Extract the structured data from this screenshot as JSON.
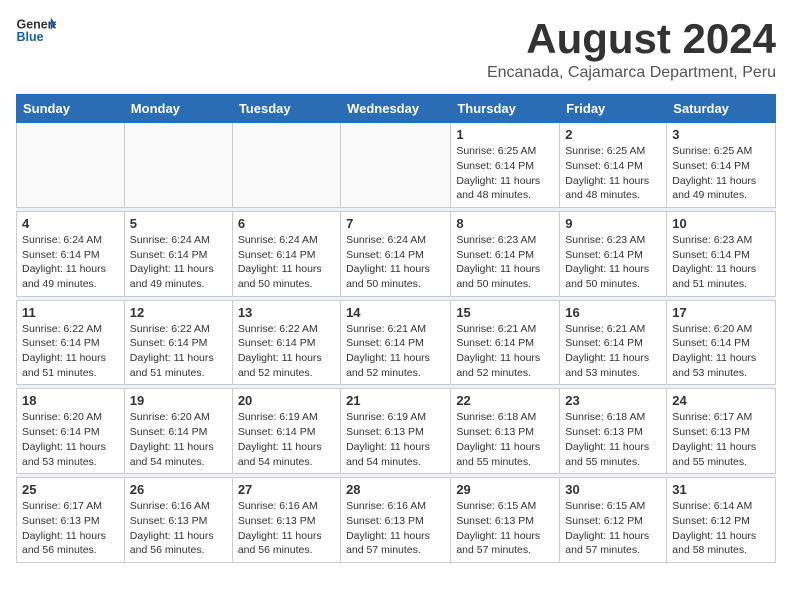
{
  "logo": {
    "general": "General",
    "blue": "Blue"
  },
  "title": {
    "month_year": "August 2024",
    "location": "Encanada, Cajamarca Department, Peru"
  },
  "weekdays": [
    "Sunday",
    "Monday",
    "Tuesday",
    "Wednesday",
    "Thursday",
    "Friday",
    "Saturday"
  ],
  "weeks": [
    [
      {
        "day": "",
        "info": ""
      },
      {
        "day": "",
        "info": ""
      },
      {
        "day": "",
        "info": ""
      },
      {
        "day": "",
        "info": ""
      },
      {
        "day": "1",
        "info": "Sunrise: 6:25 AM\nSunset: 6:14 PM\nDaylight: 11 hours\nand 48 minutes."
      },
      {
        "day": "2",
        "info": "Sunrise: 6:25 AM\nSunset: 6:14 PM\nDaylight: 11 hours\nand 48 minutes."
      },
      {
        "day": "3",
        "info": "Sunrise: 6:25 AM\nSunset: 6:14 PM\nDaylight: 11 hours\nand 49 minutes."
      }
    ],
    [
      {
        "day": "4",
        "info": "Sunrise: 6:24 AM\nSunset: 6:14 PM\nDaylight: 11 hours\nand 49 minutes."
      },
      {
        "day": "5",
        "info": "Sunrise: 6:24 AM\nSunset: 6:14 PM\nDaylight: 11 hours\nand 49 minutes."
      },
      {
        "day": "6",
        "info": "Sunrise: 6:24 AM\nSunset: 6:14 PM\nDaylight: 11 hours\nand 50 minutes."
      },
      {
        "day": "7",
        "info": "Sunrise: 6:24 AM\nSunset: 6:14 PM\nDaylight: 11 hours\nand 50 minutes."
      },
      {
        "day": "8",
        "info": "Sunrise: 6:23 AM\nSunset: 6:14 PM\nDaylight: 11 hours\nand 50 minutes."
      },
      {
        "day": "9",
        "info": "Sunrise: 6:23 AM\nSunset: 6:14 PM\nDaylight: 11 hours\nand 50 minutes."
      },
      {
        "day": "10",
        "info": "Sunrise: 6:23 AM\nSunset: 6:14 PM\nDaylight: 11 hours\nand 51 minutes."
      }
    ],
    [
      {
        "day": "11",
        "info": "Sunrise: 6:22 AM\nSunset: 6:14 PM\nDaylight: 11 hours\nand 51 minutes."
      },
      {
        "day": "12",
        "info": "Sunrise: 6:22 AM\nSunset: 6:14 PM\nDaylight: 11 hours\nand 51 minutes."
      },
      {
        "day": "13",
        "info": "Sunrise: 6:22 AM\nSunset: 6:14 PM\nDaylight: 11 hours\nand 52 minutes."
      },
      {
        "day": "14",
        "info": "Sunrise: 6:21 AM\nSunset: 6:14 PM\nDaylight: 11 hours\nand 52 minutes."
      },
      {
        "day": "15",
        "info": "Sunrise: 6:21 AM\nSunset: 6:14 PM\nDaylight: 11 hours\nand 52 minutes."
      },
      {
        "day": "16",
        "info": "Sunrise: 6:21 AM\nSunset: 6:14 PM\nDaylight: 11 hours\nand 53 minutes."
      },
      {
        "day": "17",
        "info": "Sunrise: 6:20 AM\nSunset: 6:14 PM\nDaylight: 11 hours\nand 53 minutes."
      }
    ],
    [
      {
        "day": "18",
        "info": "Sunrise: 6:20 AM\nSunset: 6:14 PM\nDaylight: 11 hours\nand 53 minutes."
      },
      {
        "day": "19",
        "info": "Sunrise: 6:20 AM\nSunset: 6:14 PM\nDaylight: 11 hours\nand 54 minutes."
      },
      {
        "day": "20",
        "info": "Sunrise: 6:19 AM\nSunset: 6:14 PM\nDaylight: 11 hours\nand 54 minutes."
      },
      {
        "day": "21",
        "info": "Sunrise: 6:19 AM\nSunset: 6:13 PM\nDaylight: 11 hours\nand 54 minutes."
      },
      {
        "day": "22",
        "info": "Sunrise: 6:18 AM\nSunset: 6:13 PM\nDaylight: 11 hours\nand 55 minutes."
      },
      {
        "day": "23",
        "info": "Sunrise: 6:18 AM\nSunset: 6:13 PM\nDaylight: 11 hours\nand 55 minutes."
      },
      {
        "day": "24",
        "info": "Sunrise: 6:17 AM\nSunset: 6:13 PM\nDaylight: 11 hours\nand 55 minutes."
      }
    ],
    [
      {
        "day": "25",
        "info": "Sunrise: 6:17 AM\nSunset: 6:13 PM\nDaylight: 11 hours\nand 56 minutes."
      },
      {
        "day": "26",
        "info": "Sunrise: 6:16 AM\nSunset: 6:13 PM\nDaylight: 11 hours\nand 56 minutes."
      },
      {
        "day": "27",
        "info": "Sunrise: 6:16 AM\nSunset: 6:13 PM\nDaylight: 11 hours\nand 56 minutes."
      },
      {
        "day": "28",
        "info": "Sunrise: 6:16 AM\nSunset: 6:13 PM\nDaylight: 11 hours\nand 57 minutes."
      },
      {
        "day": "29",
        "info": "Sunrise: 6:15 AM\nSunset: 6:13 PM\nDaylight: 11 hours\nand 57 minutes."
      },
      {
        "day": "30",
        "info": "Sunrise: 6:15 AM\nSunset: 6:12 PM\nDaylight: 11 hours\nand 57 minutes."
      },
      {
        "day": "31",
        "info": "Sunrise: 6:14 AM\nSunset: 6:12 PM\nDaylight: 11 hours\nand 58 minutes."
      }
    ]
  ]
}
